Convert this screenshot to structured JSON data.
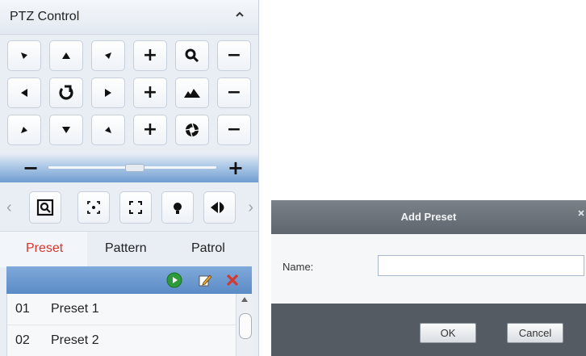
{
  "ptz": {
    "title": "PTZ Control",
    "collapse_glyph": "^",
    "plus": "+",
    "minus": "−",
    "slider": {
      "minus": "−",
      "plus": "+",
      "level": 0.5
    },
    "tabs": [
      {
        "label": "Preset",
        "active": true
      },
      {
        "label": "Pattern",
        "active": false
      },
      {
        "label": "Patrol",
        "active": false
      }
    ],
    "presets": [
      {
        "number": "01",
        "name": "Preset 1"
      },
      {
        "number": "02",
        "name": "Preset 2"
      }
    ],
    "icons": {
      "side_left": "‹",
      "side_right": "›",
      "accent": "#5b8bc6",
      "active_tab_color": "#d9342b"
    }
  },
  "dialog": {
    "title": "Add Preset",
    "name_label": "Name:",
    "name_value": "",
    "ok_label": "OK",
    "cancel_label": "Cancel"
  }
}
